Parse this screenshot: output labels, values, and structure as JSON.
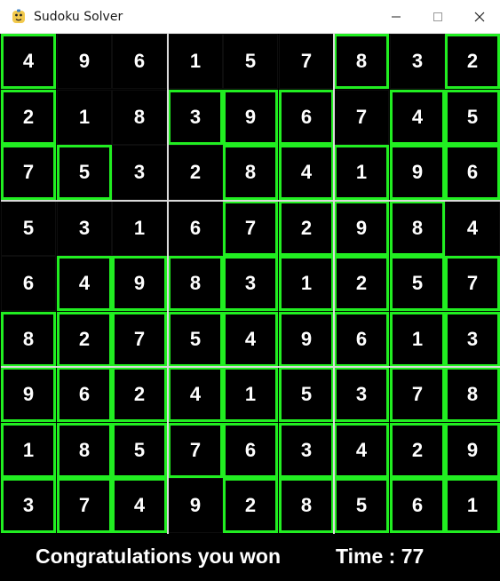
{
  "window": {
    "title": "Sudoku Solver",
    "icon": "python-snake-icon",
    "controls": [
      "minimize",
      "maximize",
      "close"
    ]
  },
  "board": {
    "grid": [
      [
        "4",
        "9",
        "6",
        "1",
        "5",
        "7",
        "8",
        "3",
        "2"
      ],
      [
        "2",
        "1",
        "8",
        "3",
        "9",
        "6",
        "7",
        "4",
        "5"
      ],
      [
        "7",
        "5",
        "3",
        "2",
        "8",
        "4",
        "1",
        "9",
        "6"
      ],
      [
        "5",
        "3",
        "1",
        "6",
        "7",
        "2",
        "9",
        "8",
        "4"
      ],
      [
        "6",
        "4",
        "9",
        "8",
        "3",
        "1",
        "2",
        "5",
        "7"
      ],
      [
        "8",
        "2",
        "7",
        "5",
        "4",
        "9",
        "6",
        "1",
        "3"
      ],
      [
        "9",
        "6",
        "2",
        "4",
        "1",
        "5",
        "3",
        "7",
        "8"
      ],
      [
        "1",
        "8",
        "5",
        "7",
        "6",
        "3",
        "4",
        "2",
        "9"
      ],
      [
        "3",
        "7",
        "4",
        "9",
        "2",
        "8",
        "5",
        "6",
        "1"
      ]
    ],
    "highlighted": [
      [
        1,
        0,
        0,
        0,
        0,
        0,
        1,
        0,
        1
      ],
      [
        1,
        0,
        0,
        1,
        1,
        1,
        0,
        1,
        1
      ],
      [
        1,
        1,
        0,
        0,
        1,
        1,
        1,
        1,
        1
      ],
      [
        0,
        0,
        0,
        0,
        1,
        1,
        1,
        1,
        0
      ],
      [
        0,
        1,
        1,
        1,
        1,
        1,
        1,
        1,
        1
      ],
      [
        1,
        1,
        1,
        1,
        1,
        1,
        1,
        1,
        1
      ],
      [
        1,
        1,
        1,
        1,
        1,
        1,
        1,
        1,
        1
      ],
      [
        1,
        1,
        1,
        1,
        1,
        1,
        1,
        1,
        1
      ],
      [
        1,
        1,
        1,
        0,
        1,
        1,
        1,
        1,
        1
      ]
    ],
    "highlight_color": "#21ee21",
    "text_color": "#ffffff",
    "background_color": "#000000"
  },
  "status": {
    "message": "Congratulations you won",
    "time_label": "Time : 77"
  }
}
